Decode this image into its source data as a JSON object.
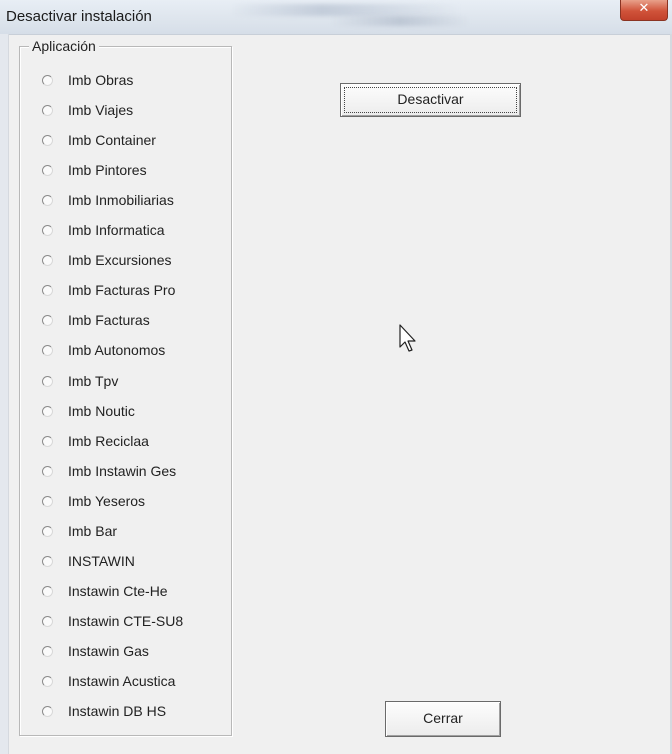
{
  "window": {
    "title": "Desactivar instalación",
    "close_glyph": "✕"
  },
  "group": {
    "legend": "Aplicación",
    "options": [
      "Imb Obras",
      "Imb Viajes",
      "Imb Container",
      "Imb Pintores",
      "Imb Inmobiliarias",
      "Imb Informatica",
      "Imb Excursiones",
      "Imb Facturas Pro",
      "Imb Facturas",
      "Imb Autonomos",
      "Imb Tpv",
      "Imb Noutic",
      "Imb Reciclaa",
      "Imb Instawin Ges",
      "Imb Yeseros",
      "Imb Bar",
      "INSTAWIN",
      "Instawin Cte-He",
      "Instawin CTE-SU8",
      "Instawin Gas",
      "Instawin Acustica",
      "Instawin DB HS"
    ]
  },
  "buttons": {
    "deactivate_label": "Desactivar",
    "close_label": "Cerrar"
  },
  "icons": {
    "close": "close-icon",
    "cursor": "mouse-pointer-icon",
    "radio": "radio-button-icon"
  }
}
